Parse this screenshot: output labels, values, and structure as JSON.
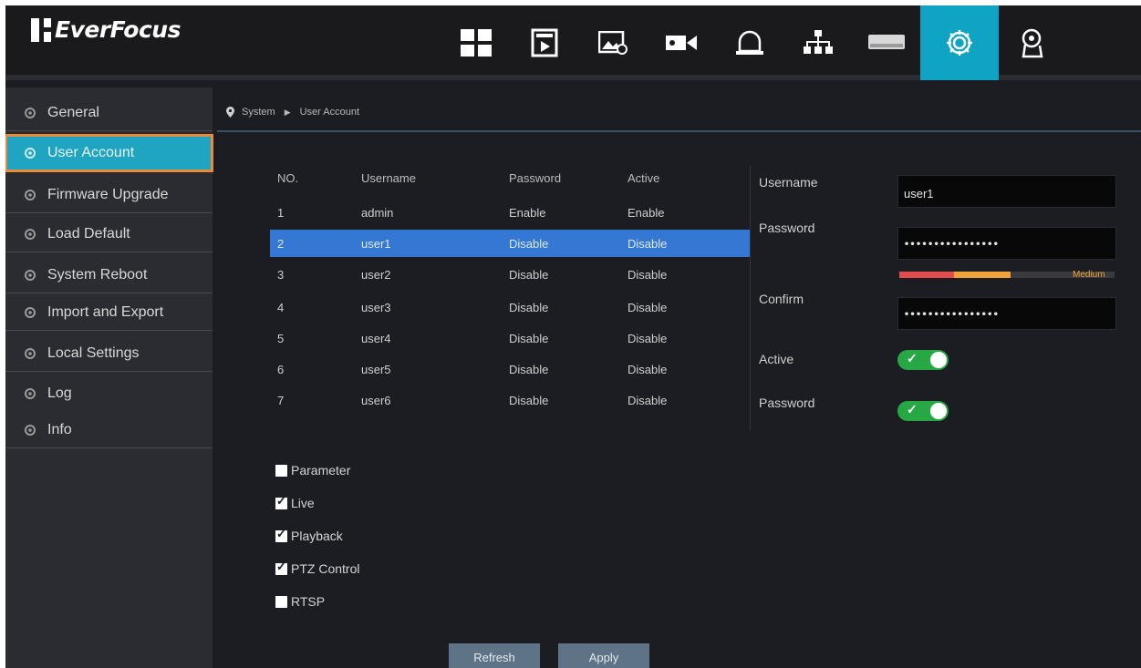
{
  "app": {
    "brand": "EverFocus"
  },
  "nav": [
    {
      "icon": "live-view-grid-icon",
      "active": false
    },
    {
      "icon": "playback-icon",
      "active": false
    },
    {
      "icon": "image-settings-icon",
      "active": false
    },
    {
      "icon": "camera-icon",
      "active": false
    },
    {
      "icon": "alarm-bell-icon",
      "active": false
    },
    {
      "icon": "network-icon",
      "active": false
    },
    {
      "icon": "storage-icon",
      "active": false
    },
    {
      "icon": "system-gear-icon",
      "active": true
    },
    {
      "icon": "advanced-icon",
      "active": false
    }
  ],
  "sidebar": {
    "items": [
      {
        "label": "General"
      },
      {
        "label": "User Account",
        "active": true
      },
      {
        "label": "Firmware Upgrade"
      },
      {
        "label": "Load Default"
      },
      {
        "label": "System Reboot"
      },
      {
        "label": "Import and Export"
      },
      {
        "label": "Local Settings"
      },
      {
        "label": "Log"
      },
      {
        "label": "Info"
      }
    ]
  },
  "breadcrumb": {
    "section": "System",
    "page": "User Account"
  },
  "table": {
    "headers": [
      "NO.",
      "Username",
      "Password",
      "Active"
    ],
    "rows": [
      [
        "1",
        "admin",
        "Enable",
        "Enable"
      ],
      [
        "2",
        "user1",
        "Disable",
        "Disable"
      ],
      [
        "3",
        "user2",
        "Disable",
        "Disable"
      ],
      [
        "4",
        "user3",
        "Disable",
        "Disable"
      ],
      [
        "5",
        "user4",
        "Disable",
        "Disable"
      ],
      [
        "6",
        "user5",
        "Disable",
        "Disable"
      ],
      [
        "7",
        "user6",
        "Disable",
        "Disable"
      ]
    ],
    "selected_row": 1
  },
  "form": {
    "username_label": "Username",
    "username_value": "user1",
    "password_label": "Password",
    "password_value": "••••••••••••••••",
    "strength_label": "Medium",
    "strength_level": 0.5,
    "confirm_label": "Confirm",
    "confirm_value": "••••••••••••••••",
    "active_label": "Active",
    "active_on": true,
    "password_toggle_label": "Password",
    "password_toggle_on": true,
    "toggle_check": "✓"
  },
  "permissions": [
    {
      "label": "Parameter",
      "checked": false
    },
    {
      "label": "Live",
      "checked": true
    },
    {
      "label": "Playback",
      "checked": true
    },
    {
      "label": "PTZ Control",
      "checked": true
    },
    {
      "label": "RTSP",
      "checked": false
    }
  ],
  "buttons": {
    "refresh": "Refresh",
    "apply": "Apply"
  },
  "colors": {
    "accent": "#0fa3c4",
    "selected_row": "#3478d4",
    "toggle_on": "#27a845",
    "highlight_outline": "#e98a3b"
  }
}
